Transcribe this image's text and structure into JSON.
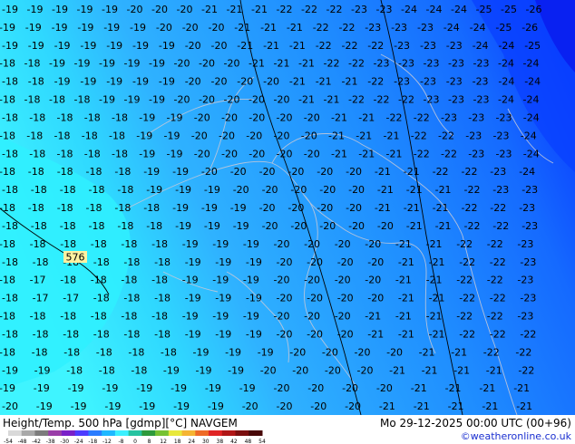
{
  "map": {
    "parameter": "Height/Temp. 500 hPa [gdmp][°C]",
    "model": "NAVGEM",
    "valid_time": "Mo 29-12-2025 00:00 UTC (00+96)",
    "credit": "©weatheronline.co.uk",
    "contour_label": "576",
    "temperature_label_grid": [
      [
        "-19",
        "-19",
        "-19",
        "-19",
        "-19",
        "-20",
        "-20",
        "-20",
        "-21",
        "-21",
        "-21",
        "-22",
        "-22",
        "-22",
        "-23",
        "-23",
        "-24",
        "-24",
        "-24",
        "-25",
        "-25",
        "-26"
      ],
      [
        "-19",
        "-19",
        "-19",
        "-19",
        "-19",
        "-19",
        "-20",
        "-20",
        "-20",
        "-21",
        "-21",
        "-21",
        "-22",
        "-22",
        "-23",
        "-23",
        "-23",
        "-24",
        "-24",
        "-25",
        "-26"
      ],
      [
        "-19",
        "-19",
        "-19",
        "-19",
        "-19",
        "-19",
        "-19",
        "-20",
        "-20",
        "-21",
        "-21",
        "-21",
        "-22",
        "-22",
        "-22",
        "-23",
        "-23",
        "-23",
        "-24",
        "-24",
        "-25"
      ],
      [
        "-18",
        "-18",
        "-19",
        "-19",
        "-19",
        "-19",
        "-19",
        "-20",
        "-20",
        "-20",
        "-21",
        "-21",
        "-21",
        "-22",
        "-22",
        "-23",
        "-23",
        "-23",
        "-23",
        "-23",
        "-24",
        "-24"
      ],
      [
        "-18",
        "-18",
        "-19",
        "-19",
        "-19",
        "-19",
        "-19",
        "-20",
        "-20",
        "-20",
        "-20",
        "-21",
        "-21",
        "-21",
        "-22",
        "-23",
        "-23",
        "-23",
        "-23",
        "-24",
        "-24"
      ],
      [
        "-18",
        "-18",
        "-18",
        "-18",
        "-19",
        "-19",
        "-19",
        "-20",
        "-20",
        "-20",
        "-20",
        "-20",
        "-21",
        "-21",
        "-22",
        "-22",
        "-22",
        "-23",
        "-23",
        "-23",
        "-24",
        "-24"
      ],
      [
        "-18",
        "-18",
        "-18",
        "-18",
        "-18",
        "-19",
        "-19",
        "-20",
        "-20",
        "-20",
        "-20",
        "-20",
        "-21",
        "-21",
        "-22",
        "-22",
        "-23",
        "-23",
        "-23",
        "-24"
      ],
      [
        "-18",
        "-18",
        "-18",
        "-18",
        "-18",
        "-19",
        "-19",
        "-20",
        "-20",
        "-20",
        "-20",
        "-20",
        "-21",
        "-21",
        "-21",
        "-22",
        "-22",
        "-23",
        "-23",
        "-24"
      ],
      [
        "-18",
        "-18",
        "-18",
        "-18",
        "-18",
        "-19",
        "-19",
        "-20",
        "-20",
        "-20",
        "-20",
        "-20",
        "-21",
        "-21",
        "-21",
        "-22",
        "-22",
        "-23",
        "-23",
        "-24"
      ],
      [
        "-18",
        "-18",
        "-18",
        "-18",
        "-18",
        "-19",
        "-19",
        "-20",
        "-20",
        "-20",
        "-20",
        "-20",
        "-20",
        "-21",
        "-21",
        "-22",
        "-22",
        "-23",
        "-24"
      ],
      [
        "-18",
        "-18",
        "-18",
        "-18",
        "-18",
        "-19",
        "-19",
        "-19",
        "-20",
        "-20",
        "-20",
        "-20",
        "-20",
        "-21",
        "-21",
        "-21",
        "-22",
        "-23",
        "-23"
      ],
      [
        "-18",
        "-18",
        "-18",
        "-18",
        "-18",
        "-18",
        "-19",
        "-19",
        "-19",
        "-20",
        "-20",
        "-20",
        "-20",
        "-21",
        "-21",
        "-21",
        "-22",
        "-22",
        "-23"
      ],
      [
        "-18",
        "-18",
        "-18",
        "-18",
        "-18",
        "-18",
        "-19",
        "-19",
        "-19",
        "-20",
        "-20",
        "-20",
        "-20",
        "-20",
        "-21",
        "-21",
        "-22",
        "-22",
        "-23"
      ],
      [
        "-18",
        "-18",
        "-18",
        "-18",
        "-18",
        "-18",
        "-19",
        "-19",
        "-19",
        "-20",
        "-20",
        "-20",
        "-20",
        "-21",
        "-21",
        "-22",
        "-22",
        "-23"
      ],
      [
        "-18",
        "-18",
        "-18",
        "-18",
        "-18",
        "-18",
        "-19",
        "-19",
        "-19",
        "-20",
        "-20",
        "-20",
        "-20",
        "-21",
        "-21",
        "-22",
        "-22",
        "-23"
      ],
      [
        "-18",
        "-17",
        "-18",
        "-18",
        "-18",
        "-18",
        "-19",
        "-19",
        "-19",
        "-20",
        "-20",
        "-20",
        "-20",
        "-21",
        "-21",
        "-22",
        "-22",
        "-23"
      ],
      [
        "-18",
        "-17",
        "-17",
        "-18",
        "-18",
        "-18",
        "-19",
        "-19",
        "-19",
        "-20",
        "-20",
        "-20",
        "-20",
        "-21",
        "-21",
        "-22",
        "-22",
        "-23"
      ],
      [
        "-18",
        "-18",
        "-18",
        "-18",
        "-18",
        "-18",
        "-19",
        "-19",
        "-19",
        "-20",
        "-20",
        "-20",
        "-21",
        "-21",
        "-21",
        "-22",
        "-22",
        "-23"
      ],
      [
        "-18",
        "-18",
        "-18",
        "-18",
        "-18",
        "-18",
        "-19",
        "-19",
        "-19",
        "-20",
        "-20",
        "-20",
        "-21",
        "-21",
        "-21",
        "-22",
        "-22",
        "-22"
      ],
      [
        "-18",
        "-18",
        "-18",
        "-18",
        "-18",
        "-18",
        "-19",
        "-19",
        "-19",
        "-20",
        "-20",
        "-20",
        "-20",
        "-21",
        "-21",
        "-22",
        "-22"
      ],
      [
        "-19",
        "-19",
        "-18",
        "-18",
        "-18",
        "-19",
        "-19",
        "-19",
        "-20",
        "-20",
        "-20",
        "-20",
        "-21",
        "-21",
        "-21",
        "-21",
        "-22"
      ],
      [
        "-19",
        "-19",
        "-19",
        "-19",
        "-19",
        "-19",
        "-19",
        "-19",
        "-20",
        "-20",
        "-20",
        "-20",
        "-21",
        "-21",
        "-21",
        "-21"
      ],
      [
        "-20",
        "-19",
        "-19",
        "-19",
        "-19",
        "-19",
        "-19",
        "-20",
        "-20",
        "-20",
        "-20",
        "-21",
        "-21",
        "-21",
        "-21",
        "-21"
      ]
    ]
  },
  "colorbar": {
    "tick_labels": [
      "-54",
      "-48",
      "-42",
      "-38",
      "-30",
      "-24",
      "-18",
      "-12",
      "-8",
      "0",
      "8",
      "12",
      "18",
      "24",
      "30",
      "38",
      "42",
      "48",
      "54"
    ],
    "colors": [
      "#d9d9d9",
      "#a8a8a8",
      "#7c7c7c",
      "#9a3ea8",
      "#7a20c8",
      "#4d3cff",
      "#2a7cff",
      "#1eb8ff",
      "#3cf0ff",
      "#26c3a0",
      "#2e9a3c",
      "#76c232",
      "#e8e83c",
      "#f5b432",
      "#ee6a26",
      "#e02424",
      "#b01616",
      "#7a0e0e",
      "#480808"
    ]
  },
  "colors": {
    "ocean_cyan": "#2ff0ff",
    "light_blue": "#39b4ff",
    "mid_blue": "#1a7cff",
    "deep_blue": "#0a3cff",
    "credit_blue": "#1a2fd0"
  }
}
